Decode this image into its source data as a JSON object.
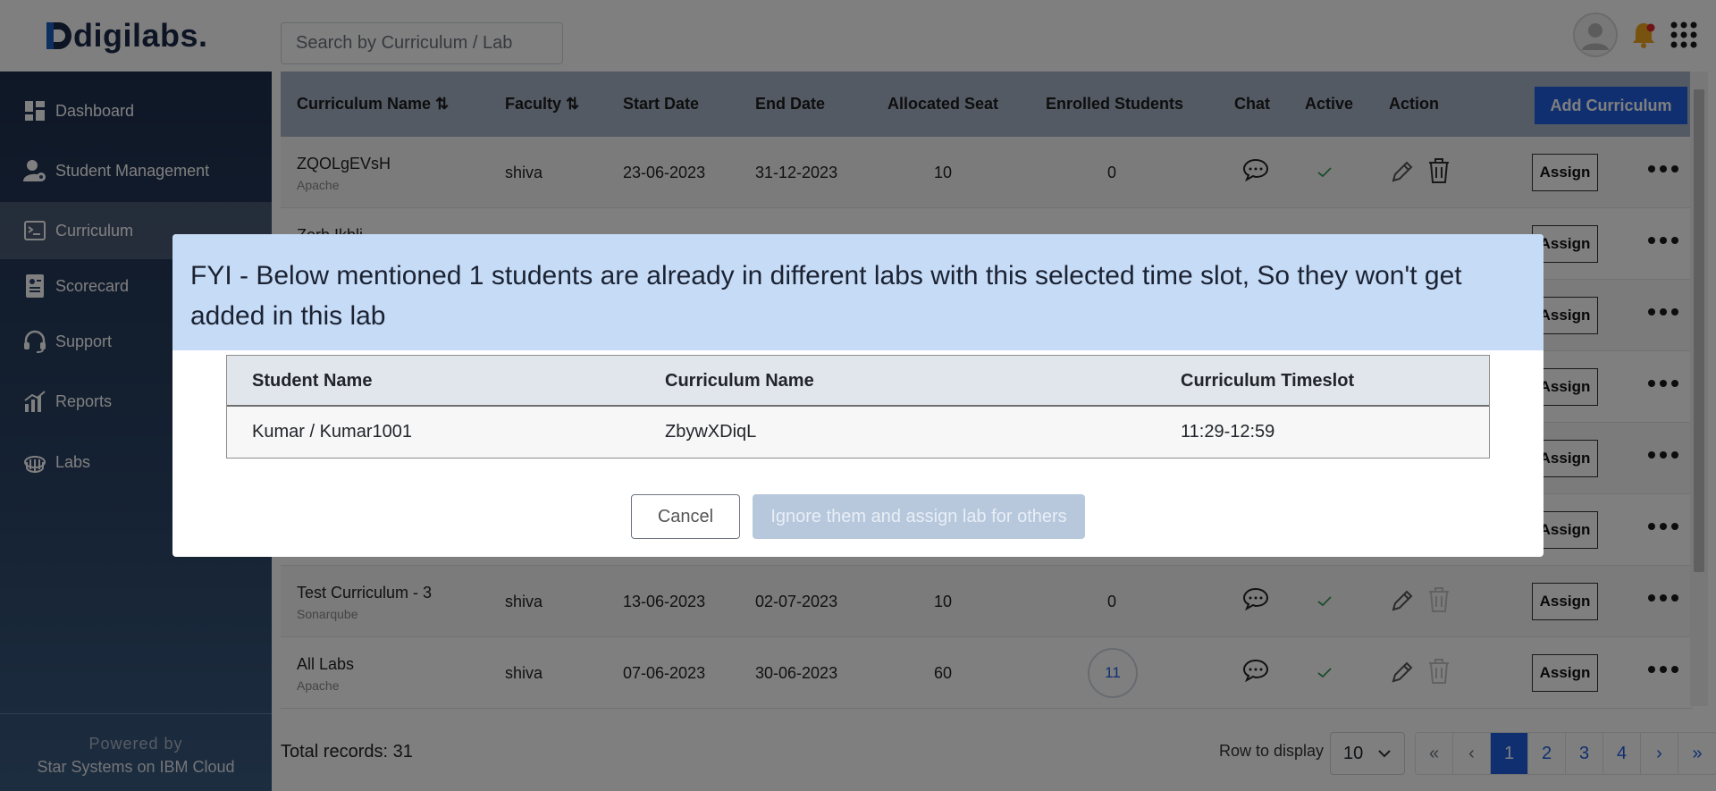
{
  "brand": {
    "name": "digilabs."
  },
  "search": {
    "placeholder": "Search by Curriculum / Lab"
  },
  "sidebar": {
    "items": [
      {
        "label": "Dashboard",
        "icon": "dashboard-icon"
      },
      {
        "label": "Student Management",
        "icon": "student-management-icon"
      },
      {
        "label": "Curriculum",
        "icon": "curriculum-icon",
        "active": true
      },
      {
        "label": "Scorecard",
        "icon": "scorecard-icon"
      },
      {
        "label": "Support",
        "icon": "headset-icon"
      },
      {
        "label": "Reports",
        "icon": "reports-icon"
      },
      {
        "label": "Labs",
        "icon": "labs-icon"
      }
    ],
    "powered_by": "Powered by",
    "powered_company": "Star Systems on IBM Cloud"
  },
  "table": {
    "headers": {
      "curriculum": "Curriculum Name ⇅",
      "faculty": "Faculty ⇅",
      "start": "Start Date",
      "end": "End Date",
      "seats": "Allocated Seat",
      "enrolled": "Enrolled Students",
      "chat": "Chat",
      "active": "Active",
      "action": "Action"
    },
    "add_button": "Add Curriculum",
    "assign_label": "Assign",
    "rows": [
      {
        "name": "ZQOLgEVsH",
        "sub": "Apache",
        "faculty": "shiva",
        "start": "23-06-2023",
        "end": "31-12-2023",
        "seats": "10",
        "enrolled": "0"
      },
      {
        "name": "Zorb Ikbli",
        "sub": "",
        "faculty": "",
        "start": "",
        "end": "",
        "seats": "",
        "enrolled": ""
      },
      {
        "name": "",
        "sub": "",
        "faculty": "",
        "start": "",
        "end": "",
        "seats": "",
        "enrolled": ""
      },
      {
        "name": "",
        "sub": "",
        "faculty": "",
        "start": "",
        "end": "",
        "seats": "",
        "enrolled": ""
      },
      {
        "name": "",
        "sub": "",
        "faculty": "",
        "start": "",
        "end": "",
        "seats": "",
        "enrolled": ""
      },
      {
        "name": "",
        "sub": "",
        "faculty": "",
        "start": "",
        "end": "",
        "seats": "",
        "enrolled": ""
      },
      {
        "name": "Test Curriculum - 3",
        "sub": "Sonarqube",
        "faculty": "shiva",
        "start": "13-06-2023",
        "end": "02-07-2023",
        "seats": "10",
        "enrolled": "0"
      },
      {
        "name": "All Labs",
        "sub": "Apache",
        "faculty": "shiva",
        "start": "07-06-2023",
        "end": "30-06-2023",
        "seats": "60",
        "enrolled": "11"
      }
    ]
  },
  "footer": {
    "total": "Total records: 31",
    "rows_label": "Row to display",
    "rows_value": "10",
    "pages": [
      "«",
      "‹",
      "1",
      "2",
      "3",
      "4",
      "›",
      "»"
    ],
    "current_page": "1"
  },
  "modal": {
    "message": "FYI - Below mentioned 1 students are already in different labs with this selected time slot, So they won't get added in this lab",
    "columns": [
      "Student Name",
      "Curriculum Name",
      "Curriculum Timeslot"
    ],
    "rows": [
      {
        "student": "Kumar / Kumar1001",
        "curriculum": "ZbywXDiqL",
        "timeslot": "11:29-12:59"
      }
    ],
    "cancel_label": "Cancel",
    "ignore_label": "Ignore them and assign lab for others"
  },
  "colors": {
    "accent": "#1f5fe0",
    "sidebar": "#1e2f4d",
    "modal_header": "#c6dbf6",
    "table_header": "#a7b4c6"
  }
}
